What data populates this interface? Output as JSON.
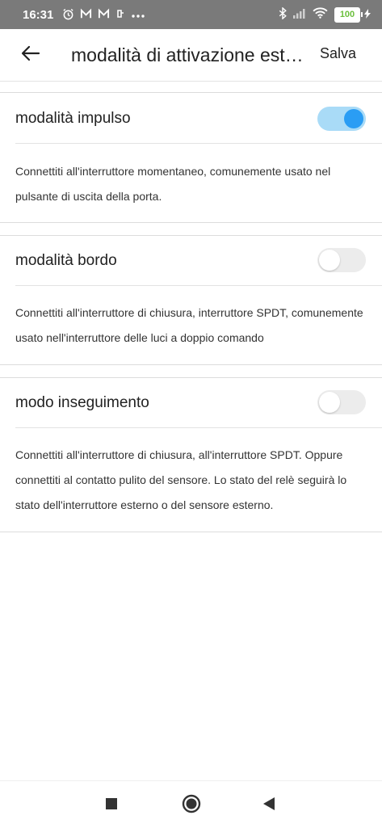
{
  "status_bar": {
    "time": "16:31",
    "battery_level": "100"
  },
  "header": {
    "title": "modalità di attivazione esterna",
    "save_label": "Salva"
  },
  "modes": [
    {
      "label": "modalità impulso",
      "enabled": true,
      "description": "Connettiti all'interruttore momentaneo, comunemente usato nel pulsante di uscita della porta."
    },
    {
      "label": "modalità bordo",
      "enabled": false,
      "description": "Connettiti all'interruttore di chiusura, interruttore SPDT, comunemente usato nell'interruttore delle luci a doppio comando"
    },
    {
      "label": "modo inseguimento",
      "enabled": false,
      "description": "Connettiti all'interruttore di chiusura, all'interruttore SPDT. Oppure connettiti al contatto pulito del sensore. Lo stato del relè seguirà lo stato dell'interruttore esterno o del sensore esterno."
    }
  ],
  "colors": {
    "toggle_on_track": "#a9dbf7",
    "toggle_on_knob": "#2a9df4",
    "toggle_off_track": "#ececec"
  },
  "icons": {
    "back": "arrow-left-icon",
    "nav_recents": "square-icon",
    "nav_home": "circle-icon",
    "nav_back": "triangle-left-icon"
  }
}
